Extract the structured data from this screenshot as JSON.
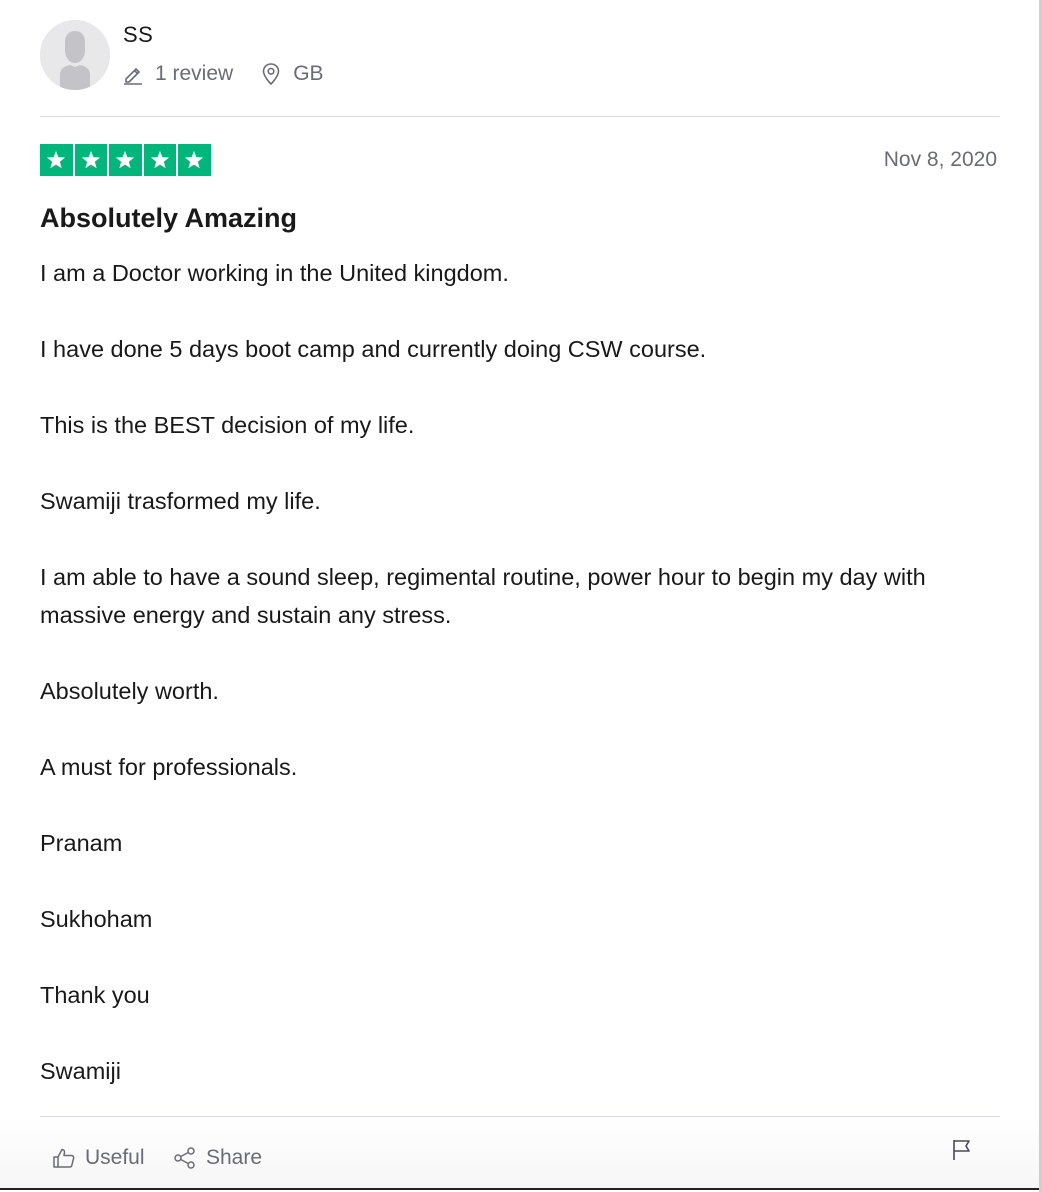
{
  "reviewer": {
    "name": "SS",
    "review_count": "1 review",
    "location": "GB",
    "avatar_icon": "default-user-avatar-icon"
  },
  "review": {
    "rating": 5,
    "rating_max": 5,
    "star_color": "#00b67a",
    "date": "Nov 8, 2020",
    "title": "Absolutely Amazing",
    "paragraphs": [
      "I am a Doctor working in the United kingdom.",
      "I have done 5 days boot camp and currently doing CSW course.",
      "This is the BEST decision of my life.",
      "Swamiji trasformed my life.",
      "I am able to have a sound sleep, regimental routine, power hour to begin my day with massive energy and sustain any stress.",
      "Absolutely worth.",
      "A must for professionals.",
      "Pranam",
      "Sukhoham",
      "Thank you",
      "Swamiji"
    ]
  },
  "actions": {
    "useful_label": "Useful",
    "share_label": "Share",
    "useful_icon": "thumbs-up-icon",
    "share_icon": "share-icon",
    "flag_icon": "flag-icon"
  },
  "colors": {
    "text": "#191919",
    "muted": "#6b6b78",
    "divider": "#dcdce6"
  }
}
